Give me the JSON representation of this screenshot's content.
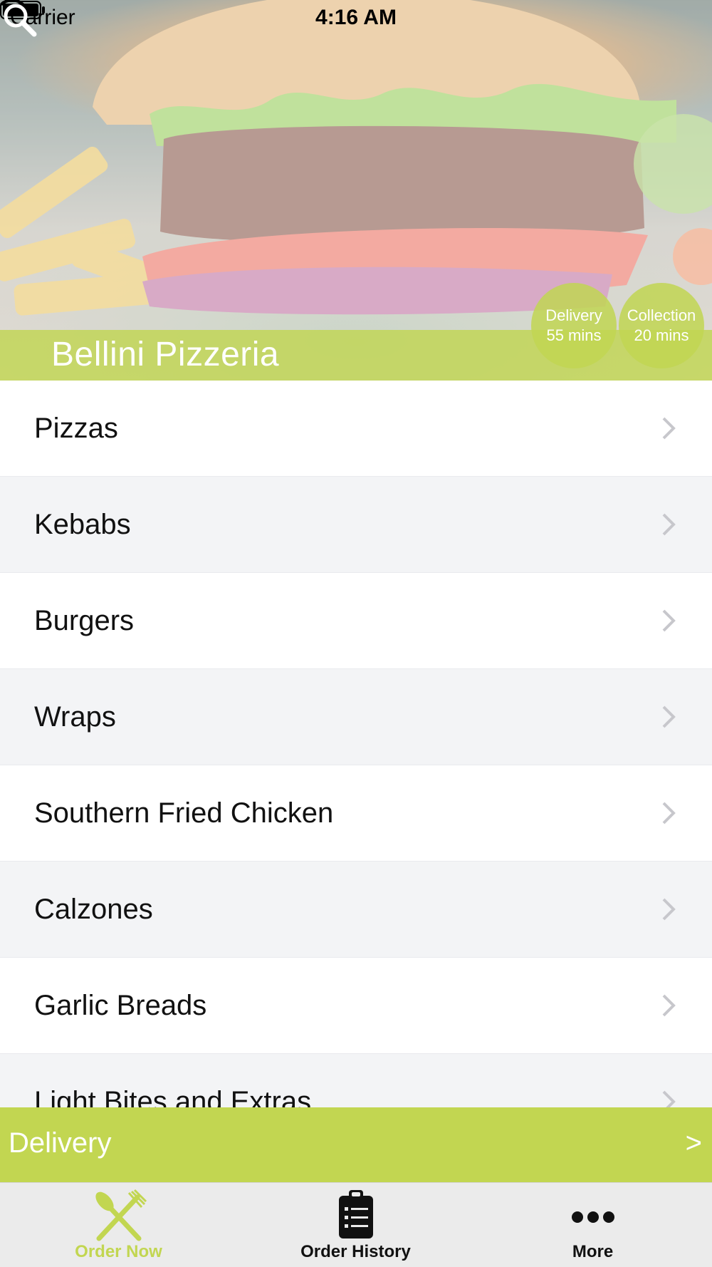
{
  "status_bar": {
    "carrier": "Carrier",
    "time": "4:16 AM",
    "wifi_icon": "wifi-icon",
    "battery_icon": "battery-icon"
  },
  "header": {
    "restaurant_name": "Bellini Pizzeria",
    "search_icon": "search-icon",
    "delivery_time": {
      "label": "Delivery",
      "value": "55 mins"
    },
    "collection_time": {
      "label": "Collection",
      "value": "20 mins"
    }
  },
  "menu": {
    "items": [
      {
        "label": "Pizzas"
      },
      {
        "label": "Kebabs"
      },
      {
        "label": "Burgers"
      },
      {
        "label": "Wraps"
      },
      {
        "label": "Southern Fried Chicken"
      },
      {
        "label": "Calzones"
      },
      {
        "label": "Garlic Breads"
      },
      {
        "label": "Light Bites and Extras"
      }
    ],
    "chevron_icon": "chevron-right-icon"
  },
  "delivery_bar": {
    "label": "Delivery",
    "arrow": ">"
  },
  "tab_bar": {
    "tabs": [
      {
        "label": "Order Now",
        "icon": "fork-knife-icon",
        "active": true
      },
      {
        "label": "Order History",
        "icon": "clipboard-list-icon",
        "active": false
      },
      {
        "label": "More",
        "icon": "more-dots-icon",
        "active": false
      }
    ]
  },
  "colors": {
    "accent": "#c2d651",
    "row_alt": "#f3f4f6",
    "tab_bar_bg": "#ebebeb"
  }
}
